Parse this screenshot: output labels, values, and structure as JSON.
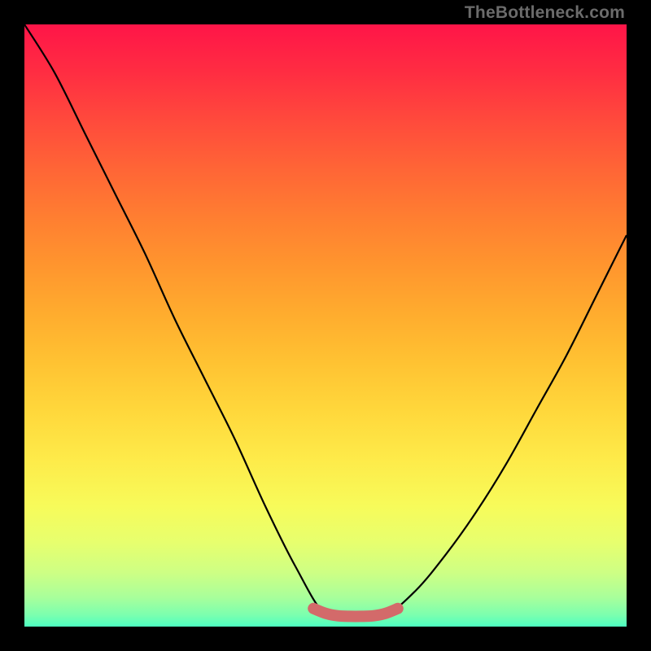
{
  "watermark": "TheBottleneck.com",
  "chart_data": {
    "type": "line",
    "title": "",
    "xlabel": "",
    "ylabel": "",
    "xlim": [
      0,
      1
    ],
    "ylim": [
      0,
      1
    ],
    "series": [
      {
        "name": "bottleneck-curve",
        "color": "#000000",
        "x": [
          0.0,
          0.05,
          0.1,
          0.15,
          0.2,
          0.25,
          0.3,
          0.35,
          0.4,
          0.45,
          0.5,
          0.55,
          0.6,
          0.65,
          0.7,
          0.75,
          0.8,
          0.85,
          0.9,
          0.95,
          1.0
        ],
        "y": [
          1.0,
          0.92,
          0.82,
          0.72,
          0.62,
          0.51,
          0.41,
          0.31,
          0.2,
          0.1,
          0.02,
          0.02,
          0.02,
          0.06,
          0.12,
          0.19,
          0.27,
          0.36,
          0.45,
          0.55,
          0.65
        ]
      },
      {
        "name": "optimal-plateau-highlight",
        "color": "#d36a6a",
        "x": [
          0.48,
          0.5,
          0.52,
          0.54,
          0.56,
          0.58,
          0.6,
          0.62
        ],
        "y": [
          0.03,
          0.022,
          0.018,
          0.017,
          0.017,
          0.018,
          0.022,
          0.03
        ]
      }
    ],
    "background_gradient": {
      "type": "vertical",
      "stops": [
        {
          "pos": 0.0,
          "color": "#ff1548"
        },
        {
          "pos": 0.5,
          "color": "#ffc232"
        },
        {
          "pos": 0.8,
          "color": "#f7fb5a"
        },
        {
          "pos": 1.0,
          "color": "#4dffc0"
        }
      ]
    }
  }
}
